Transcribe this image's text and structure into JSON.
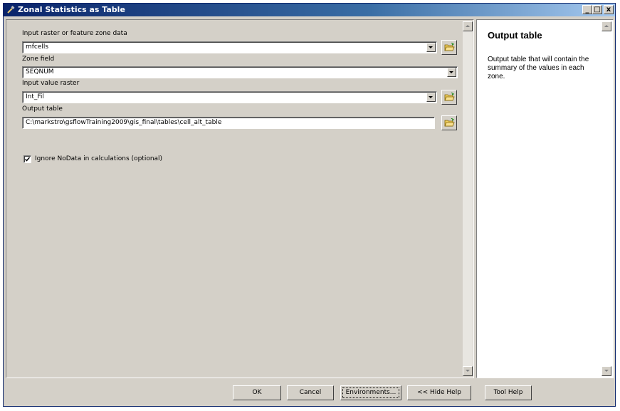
{
  "window": {
    "title": "Zonal Statistics as Table",
    "minimize": "_",
    "maximize": "□",
    "close": "x"
  },
  "form": {
    "zone_data_label": "Input raster or feature zone data",
    "zone_data_value": "mfcells",
    "zone_field_label": "Zone field",
    "zone_field_value": "SEQNUM",
    "value_raster_label": "Input value raster",
    "value_raster_value": "Int_Fil",
    "output_table_label": "Output table",
    "output_table_value": "C:\\markstro\\gsflowTraining2009\\gis_final\\tables\\cell_alt_table",
    "ignore_nodata_label": "Ignore NoData in calculations (optional)",
    "ignore_nodata_checked": true
  },
  "help": {
    "title": "Output table",
    "text": "Output table that will contain the summary of the values in each zone."
  },
  "buttons": {
    "ok": "OK",
    "cancel": "Cancel",
    "environments": "Environments...",
    "hide_help": "<< Hide Help",
    "tool_help": "Tool Help"
  }
}
